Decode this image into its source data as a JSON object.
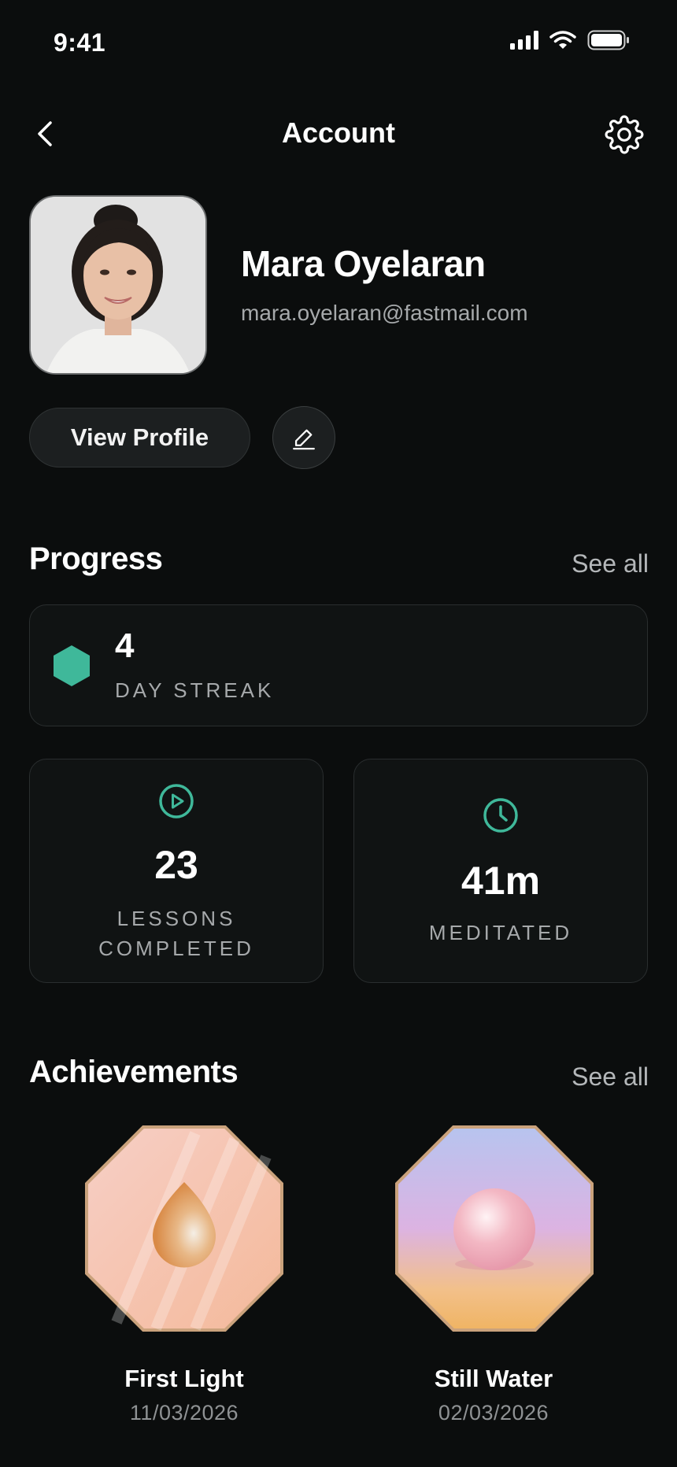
{
  "status_bar": {
    "time": "9:41",
    "icons": [
      "signal-icon",
      "wifi-icon",
      "battery-icon"
    ]
  },
  "nav": {
    "title": "Account",
    "back_icon": "chevron-left-icon",
    "settings_icon": "gear-icon"
  },
  "profile": {
    "name": "Mara Oyelaran",
    "email": "mara.oyelaran@fastmail.com",
    "view_profile_label": "View Profile",
    "edit_icon": "pencil-icon"
  },
  "progress": {
    "title": "Progress",
    "see_all": "See all",
    "streak": {
      "value": "4",
      "label": "DAY STREAK"
    },
    "stats": [
      {
        "icon": "play-circle-icon",
        "value": "23",
        "label_line1": "LESSONS",
        "label_line2": "COMPLETED"
      },
      {
        "icon": "clock-icon",
        "value": "41m",
        "label_line1": "MEDITATED"
      }
    ]
  },
  "achievements": {
    "title": "Achievements",
    "see_all": "See all",
    "items": [
      {
        "title": "First Light",
        "date": "11/03/2026"
      },
      {
        "title": "Still Water",
        "date": "02/03/2026"
      }
    ]
  },
  "colors": {
    "background": "#0b0d0d",
    "accent": "#3fb89a",
    "muted": "#a6a9ab"
  }
}
